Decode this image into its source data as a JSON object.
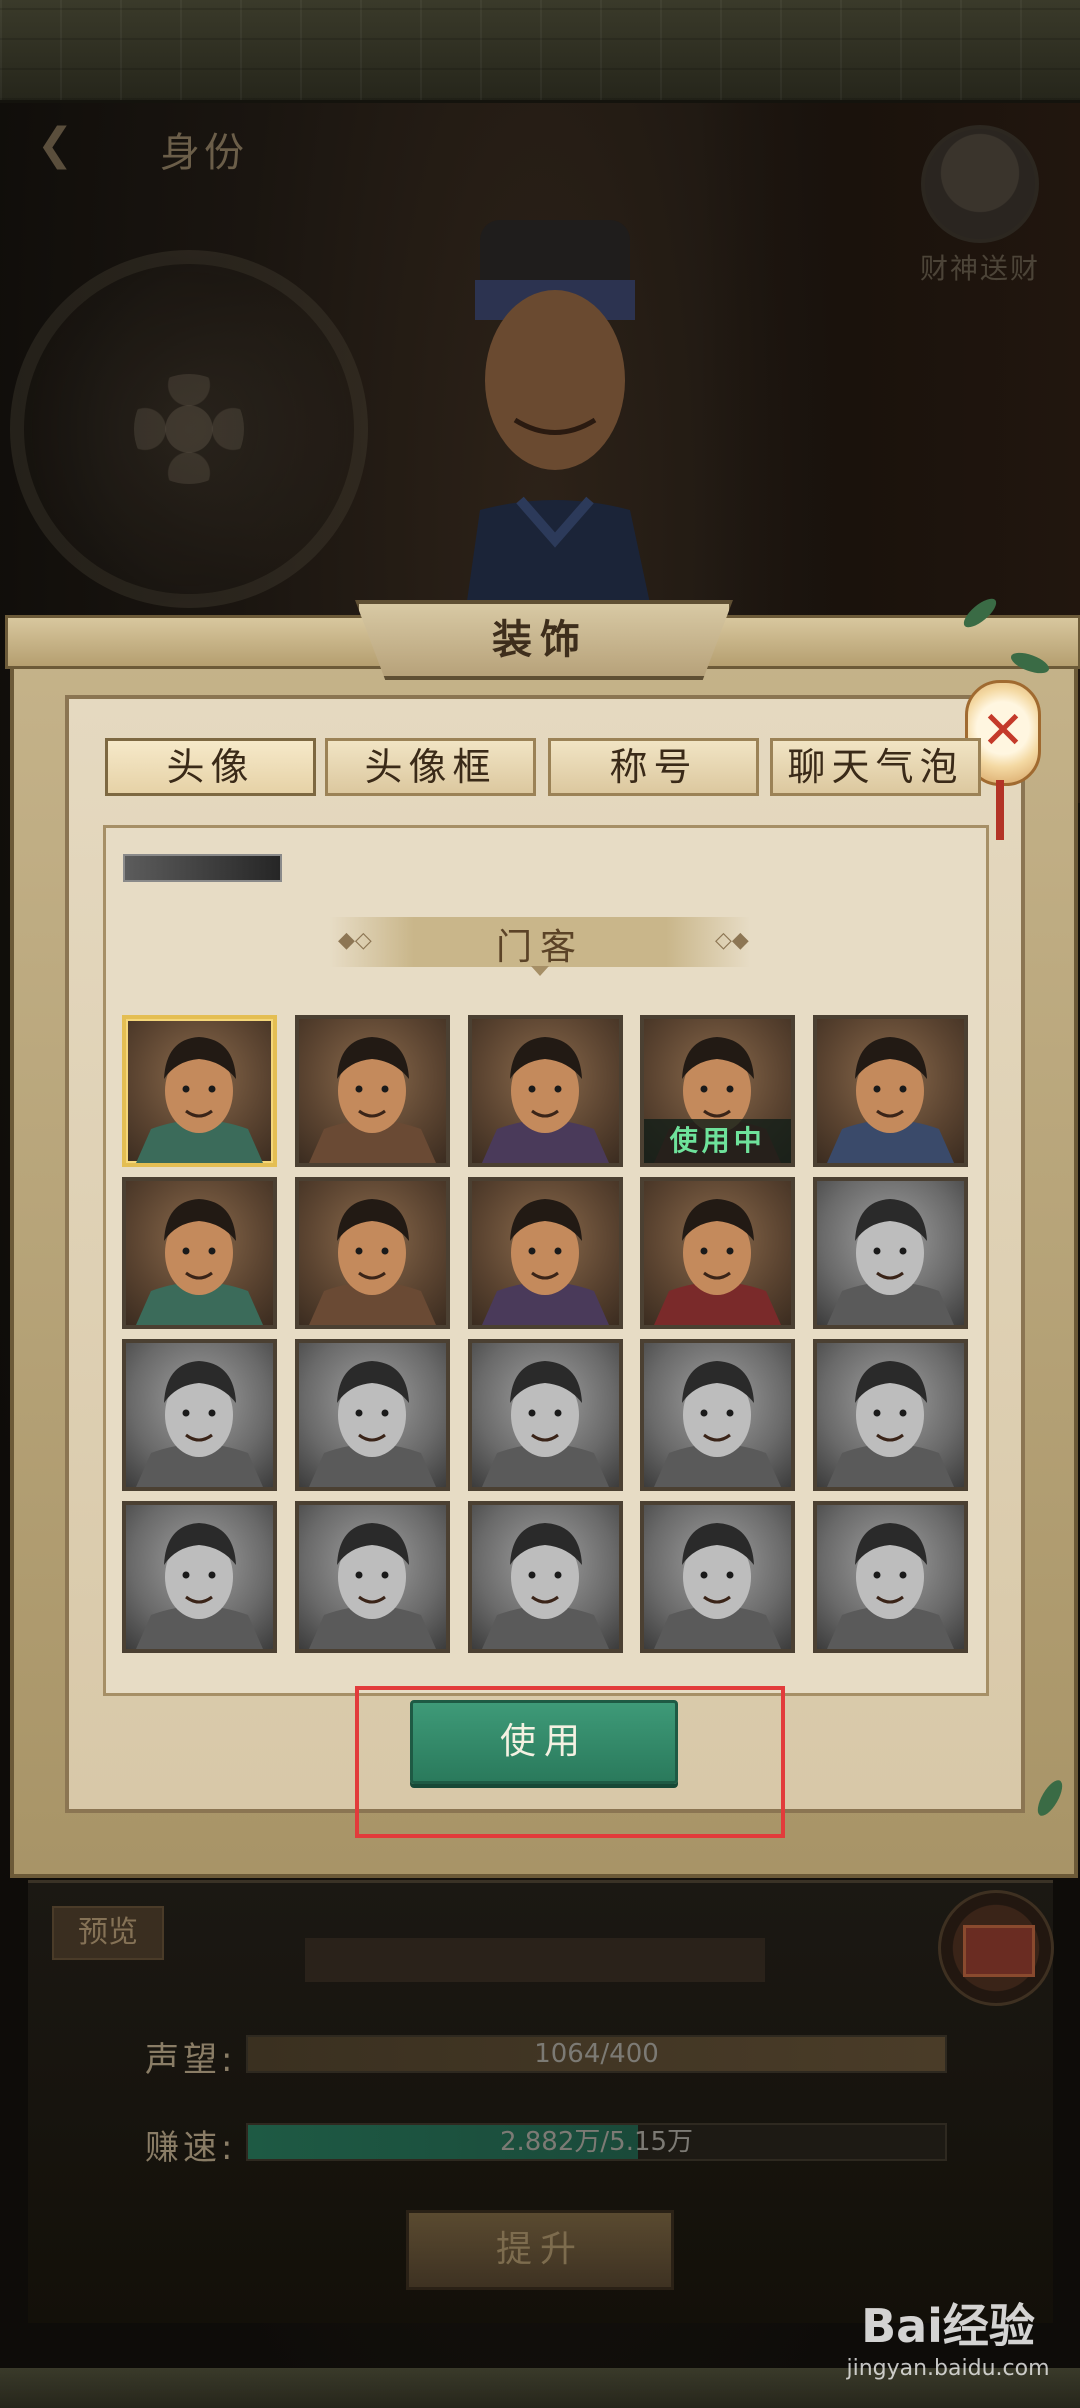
{
  "header": {
    "title": "身份",
    "god_of_wealth": "财神送财"
  },
  "panel": {
    "title": "装饰",
    "tabs": [
      "头像",
      "头像框",
      "称号",
      "聊天气泡"
    ],
    "active_tab": "头像",
    "section_title": "门客",
    "in_use_label": "使用中",
    "use_button": "使用"
  },
  "avatars": [
    {
      "style": "color",
      "selected": true,
      "in_use": false
    },
    {
      "style": "color",
      "selected": false,
      "in_use": false
    },
    {
      "style": "color",
      "selected": false,
      "in_use": false
    },
    {
      "style": "color",
      "selected": false,
      "in_use": true
    },
    {
      "style": "color",
      "selected": false,
      "in_use": false
    },
    {
      "style": "color",
      "selected": false,
      "in_use": false
    },
    {
      "style": "color",
      "selected": false,
      "in_use": false
    },
    {
      "style": "color",
      "selected": false,
      "in_use": false
    },
    {
      "style": "color",
      "selected": false,
      "in_use": false
    },
    {
      "style": "gray",
      "selected": false,
      "in_use": false
    },
    {
      "style": "gray",
      "selected": false,
      "in_use": false
    },
    {
      "style": "gray",
      "selected": false,
      "in_use": false
    },
    {
      "style": "gray",
      "selected": false,
      "in_use": false
    },
    {
      "style": "gray",
      "selected": false,
      "in_use": false
    },
    {
      "style": "gray",
      "selected": false,
      "in_use": false
    },
    {
      "style": "gray",
      "selected": false,
      "in_use": false
    },
    {
      "style": "gray",
      "selected": false,
      "in_use": false
    },
    {
      "style": "gray",
      "selected": false,
      "in_use": false
    },
    {
      "style": "gray",
      "selected": false,
      "in_use": false
    },
    {
      "style": "gray",
      "selected": false,
      "in_use": false
    }
  ],
  "bottom": {
    "preview_button": "预览",
    "reputation_label": "声望:",
    "reputation_value": "1064/400",
    "reputation_fill": 1.0,
    "earn_label": "赚速:",
    "earn_value": "2.882万/5.15万",
    "earn_fill": 0.56,
    "raise_button": "提升"
  },
  "watermark": {
    "main": "Bai经验",
    "sub": "jingyan.baidu.com"
  },
  "colors": {
    "accent_green": "#2a7a5c",
    "in_use_text": "#6ee29b",
    "highlight": "#e23b3b",
    "selected_border": "#e4be53"
  }
}
